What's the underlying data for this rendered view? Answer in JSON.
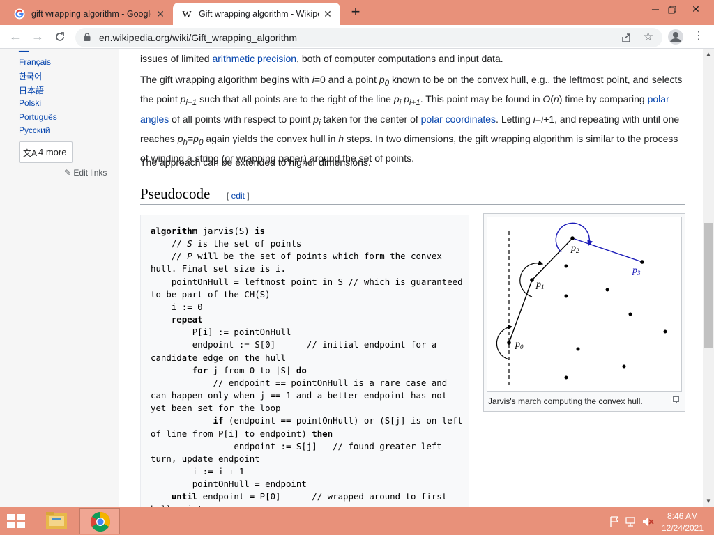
{
  "browser": {
    "tabs": [
      {
        "title": "gift wrapping algorithm - Google Search",
        "active": false
      },
      {
        "title": "Gift wrapping algorithm - Wikipedia",
        "active": true
      }
    ],
    "url": "en.wikipedia.org/wiki/Gift_wrapping_algorithm",
    "accent_color": "#e8917a"
  },
  "sidebar": {
    "languages": [
      "Français",
      "한국어",
      "日本語",
      "Polski",
      "Português",
      "Русский"
    ],
    "more_label": "4 more",
    "edit_links_label": "Edit links"
  },
  "article": {
    "para1_text": "issues of limited ",
    "para1_link": "arithmetic precision",
    "para1_tail": ", both of computer computations and input data.",
    "para3_text": "The approach can be extended to higher dimensions.",
    "heading": "Pseudocode",
    "heading_edit_link": "edit",
    "figure_caption": "Jarvis's march computing the convex hull.",
    "figure_labels": [
      "p0",
      "p1",
      "p2",
      "p3"
    ]
  },
  "taskbar": {
    "time": "8:46 AM",
    "date": "12/24/2021"
  }
}
